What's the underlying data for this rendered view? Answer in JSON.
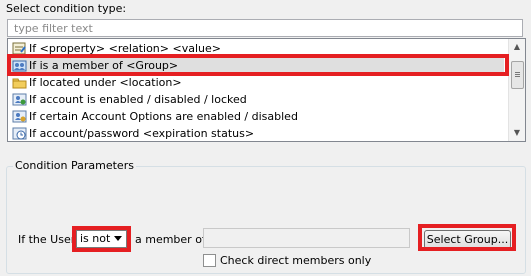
{
  "header": {
    "title": "Select condition type:"
  },
  "filter": {
    "placeholder": "type filter text"
  },
  "conditions": [
    {
      "label": "If <property> <relation> <value>",
      "icon": "property-icon"
    },
    {
      "label": "If is a member of <Group>",
      "icon": "group-icon",
      "selected": true
    },
    {
      "label": "If located under <location>",
      "icon": "folder-icon"
    },
    {
      "label": "If account is enabled / disabled / locked",
      "icon": "account-icon"
    },
    {
      "label": "If certain Account Options are enabled / disabled",
      "icon": "account-options-icon"
    },
    {
      "label": "If account/password <expiration status>",
      "icon": "clock-icon"
    }
  ],
  "params": {
    "title": "Condition Parameters",
    "if_the_user": "If the User",
    "relation_value": "is not",
    "a_member_of": "a member of",
    "select_group_button": "Select Group...",
    "check_direct_label": "Check direct members only"
  },
  "colors": {
    "highlight": "#e51f22",
    "selection": "#dfdfdf"
  }
}
